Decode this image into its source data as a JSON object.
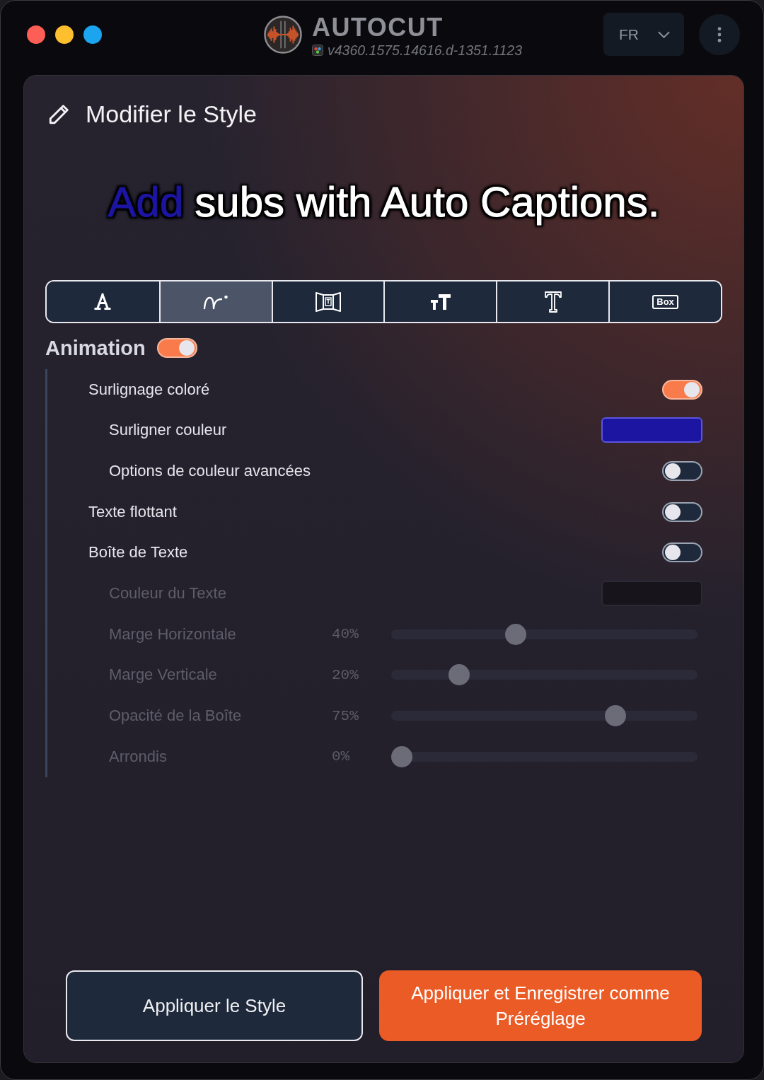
{
  "window": {
    "title": "AUTOCUT",
    "version": "v4360.1575.14616.d-1351.1123"
  },
  "window_controls": [
    {
      "color": "#fd5e56"
    },
    {
      "color": "#fdbf2d"
    },
    {
      "color": "#1ba5ef"
    }
  ],
  "language_select": {
    "value": "FR"
  },
  "panel": {
    "title": "Modifier le Style"
  },
  "preview": {
    "highlighted_word": "Add",
    "text": "subs with Auto Captions."
  },
  "tabs": [
    {
      "kind": "font",
      "selected": false
    },
    {
      "kind": "animation",
      "selected": true
    },
    {
      "kind": "position",
      "selected": false
    },
    {
      "kind": "size",
      "selected": false
    },
    {
      "kind": "typeface",
      "selected": false
    },
    {
      "kind": "box",
      "label": "Box",
      "selected": false
    }
  ],
  "animation": {
    "label": "Animation",
    "on": true,
    "rows": [
      {
        "kind": "toggle",
        "label": "Surlignage coloré",
        "on": true,
        "children": [
          {
            "kind": "color",
            "label": "Surligner couleur",
            "color": "#1c15a2"
          },
          {
            "kind": "toggle",
            "label": "Options de couleur avancées",
            "on": false
          }
        ]
      },
      {
        "kind": "toggle",
        "label": "Texte flottant",
        "on": false
      },
      {
        "kind": "toggle",
        "label": "Boîte de Texte",
        "on": false,
        "children": [
          {
            "kind": "color",
            "label": "Couleur du Texte",
            "color": "#17151b"
          },
          {
            "kind": "slider",
            "label": "Marge Horizontale",
            "reading": "40%",
            "level": 0.4
          },
          {
            "kind": "slider",
            "label": "Marge Verticale",
            "reading": "20%",
            "level": 0.2
          },
          {
            "kind": "slider",
            "label": "Opacité de la Boîte",
            "reading": "75%",
            "level": 0.75
          },
          {
            "kind": "slider",
            "label": "Arrondis",
            "reading": "0%",
            "level": 0
          }
        ]
      }
    ]
  },
  "buttons": [
    {
      "label": "Appliquer le Style",
      "kind": "secondary"
    },
    {
      "label": "Appliquer et Enregistrer comme Préréglage",
      "kind": "primary"
    }
  ]
}
